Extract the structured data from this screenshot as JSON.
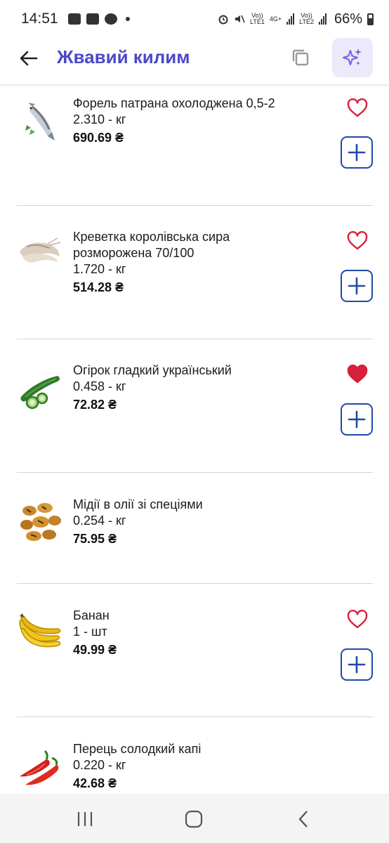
{
  "status_bar": {
    "time": "14:51",
    "net1": "Vo))\nLTE1",
    "net2": "4G+",
    "net3": "Vo))\nLTE2",
    "battery": "66%"
  },
  "header": {
    "title": "Жвавий килим",
    "back_icon": "arrow-left-icon",
    "copy_icon": "copy-icon",
    "ai_icon": "sparkles-icon"
  },
  "colors": {
    "accent": "#4b48c9",
    "button_border": "#1f4aa6",
    "heart": "#d8203b"
  },
  "items": [
    {
      "name": "Форель патрана охолоджена 0,5-2",
      "qty": "2.310 - кг",
      "price": "690.69 ₴",
      "favorite": false,
      "image": "trout"
    },
    {
      "name": "Креветка королівська сира розморожена 70/100",
      "qty": "1.720 - кг",
      "price": "514.28 ₴",
      "favorite": false,
      "image": "shrimp"
    },
    {
      "name": "Огірок гладкий український",
      "qty": "0.458 - кг",
      "price": "72.82 ₴",
      "favorite": true,
      "image": "cucumber"
    },
    {
      "name": "Мідії в олії зі спеціями",
      "qty": "0.254 - кг",
      "price": "75.95 ₴",
      "favorite": false,
      "image": "mussels"
    },
    {
      "name": "Банан",
      "qty": "1 - шт",
      "price": "49.99 ₴",
      "favorite": false,
      "image": "banana"
    },
    {
      "name": "Перець солодкий капі",
      "qty": "0.220 - кг",
      "price": "42.68 ₴",
      "favorite": false,
      "image": "pepper"
    }
  ],
  "nav": {
    "recents_icon": "recents-icon",
    "home_icon": "home-icon",
    "back_icon": "back-chevron-icon"
  }
}
